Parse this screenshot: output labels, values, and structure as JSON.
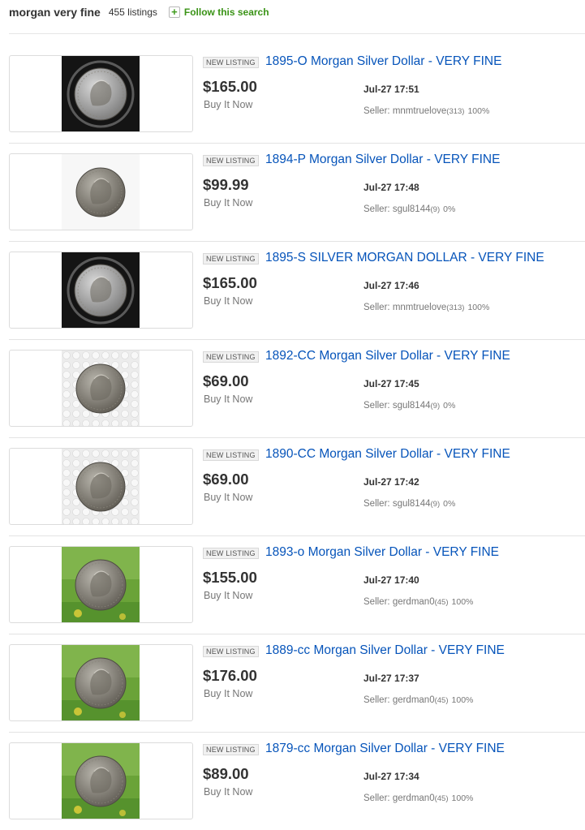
{
  "search": {
    "query": "morgan very fine",
    "count_text": "455 listings",
    "follow_label": "Follow this search",
    "follow_icon": "plus-icon"
  },
  "colors": {
    "link": "#0654ba",
    "follow": "#3a9316",
    "dark_backdrop": "#141414",
    "light_backdrop": "#dcdcdc",
    "bubble_backdrop": "#ececec",
    "grass_backdrop": "#6aa338"
  },
  "listings": [
    {
      "badge": "NEW LISTING",
      "title": "1895-O Morgan Silver Dollar - VERY FINE",
      "price": "$165.00",
      "format": "Buy It Now",
      "time": "Jul-27 17:51",
      "seller_prefix": "Seller:",
      "seller_name": "mnmtruelove",
      "feedback": "(313)",
      "positive": "100%",
      "photo": "dark"
    },
    {
      "badge": "NEW LISTING",
      "title": "1894-P Morgan Silver Dollar - VERY FINE",
      "price": "$99.99",
      "format": "Buy It Now",
      "time": "Jul-27 17:48",
      "seller_prefix": "Seller:",
      "seller_name": "sgul8144",
      "feedback": "(9)",
      "positive": "0%",
      "photo": "white"
    },
    {
      "badge": "NEW LISTING",
      "title": "1895-S SILVER MORGAN DOLLAR - VERY FINE",
      "price": "$165.00",
      "format": "Buy It Now",
      "time": "Jul-27 17:46",
      "seller_prefix": "Seller:",
      "seller_name": "mnmtruelove",
      "feedback": "(313)",
      "positive": "100%",
      "photo": "dark"
    },
    {
      "badge": "NEW LISTING",
      "title": "1892-CC Morgan Silver Dollar - VERY FINE",
      "price": "$69.00",
      "format": "Buy It Now",
      "time": "Jul-27 17:45",
      "seller_prefix": "Seller:",
      "seller_name": "sgul8144",
      "feedback": "(9)",
      "positive": "0%",
      "photo": "bubble"
    },
    {
      "badge": "NEW LISTING",
      "title": "1890-CC Morgan Silver Dollar - VERY FINE",
      "price": "$69.00",
      "format": "Buy It Now",
      "time": "Jul-27 17:42",
      "seller_prefix": "Seller:",
      "seller_name": "sgul8144",
      "feedback": "(9)",
      "positive": "0%",
      "photo": "bubble"
    },
    {
      "badge": "NEW LISTING",
      "title": "1893-o Morgan Silver Dollar - VERY FINE",
      "price": "$155.00",
      "format": "Buy It Now",
      "time": "Jul-27 17:40",
      "seller_prefix": "Seller:",
      "seller_name": "gerdman0",
      "feedback": "(45)",
      "positive": "100%",
      "photo": "grass"
    },
    {
      "badge": "NEW LISTING",
      "title": "1889-cc Morgan Silver Dollar - VERY FINE",
      "price": "$176.00",
      "format": "Buy It Now",
      "time": "Jul-27 17:37",
      "seller_prefix": "Seller:",
      "seller_name": "gerdman0",
      "feedback": "(45)",
      "positive": "100%",
      "photo": "grass"
    },
    {
      "badge": "NEW LISTING",
      "title": "1879-cc Morgan Silver Dollar - VERY FINE",
      "price": "$89.00",
      "format": "Buy It Now",
      "time": "Jul-27 17:34",
      "seller_prefix": "Seller:",
      "seller_name": "gerdman0",
      "feedback": "(45)",
      "positive": "100%",
      "photo": "grass"
    }
  ]
}
